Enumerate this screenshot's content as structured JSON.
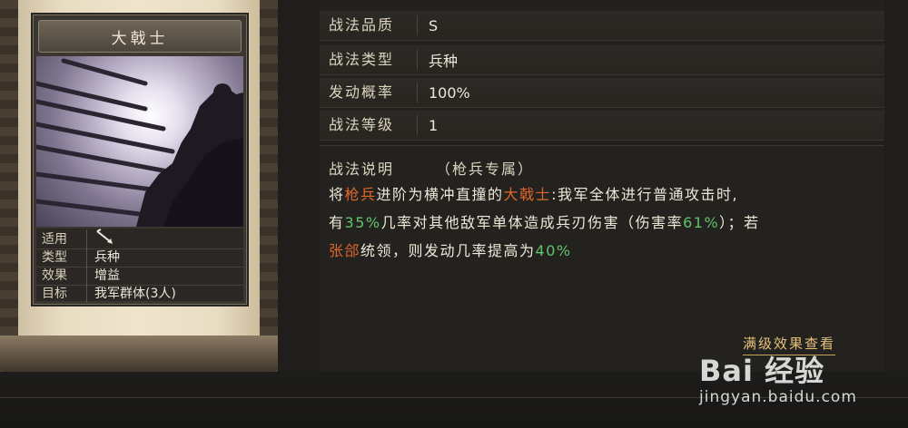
{
  "card": {
    "title": "大戟士",
    "attrs": [
      {
        "label": "适用",
        "value": ""
      },
      {
        "label": "类型",
        "value": "兵种"
      },
      {
        "label": "效果",
        "value": "增益"
      },
      {
        "label": "目标",
        "value": "我军群体(3人)"
      }
    ],
    "applies_icon": "spear-icon"
  },
  "info": [
    {
      "label": "战法品质",
      "value": "S"
    },
    {
      "label": "战法类型",
      "value": "兵种"
    },
    {
      "label": "发动概率",
      "value": "100%"
    },
    {
      "label": "战法等级",
      "value": "1"
    }
  ],
  "description": {
    "title": "战法说明",
    "subtitle": "（枪兵专属）",
    "line1_a": "将",
    "line1_unit": "枪兵",
    "line1_b": "进阶为横冲直撞的",
    "line1_name": "大戟士",
    "line1_c": ":我军全体进行普通攻击时,",
    "line2_a": "有",
    "line2_pct1": "35%",
    "line2_b": "几率对其他敌军单体造成兵刃伤害（伤害率",
    "line2_pct2": "61%",
    "line2_c": "）；若",
    "line3_general": "张郃",
    "line3_a": "统领，则发动几率提高为",
    "line3_pct": "40%"
  },
  "full_effect_link": "满级效果查看",
  "watermark": {
    "logo": "Bai 经验",
    "url": "jingyan.baidu.com"
  },
  "colors": {
    "highlight_orange": "#e0672a",
    "highlight_green": "#5fc46a",
    "link": "#e6c27a"
  }
}
